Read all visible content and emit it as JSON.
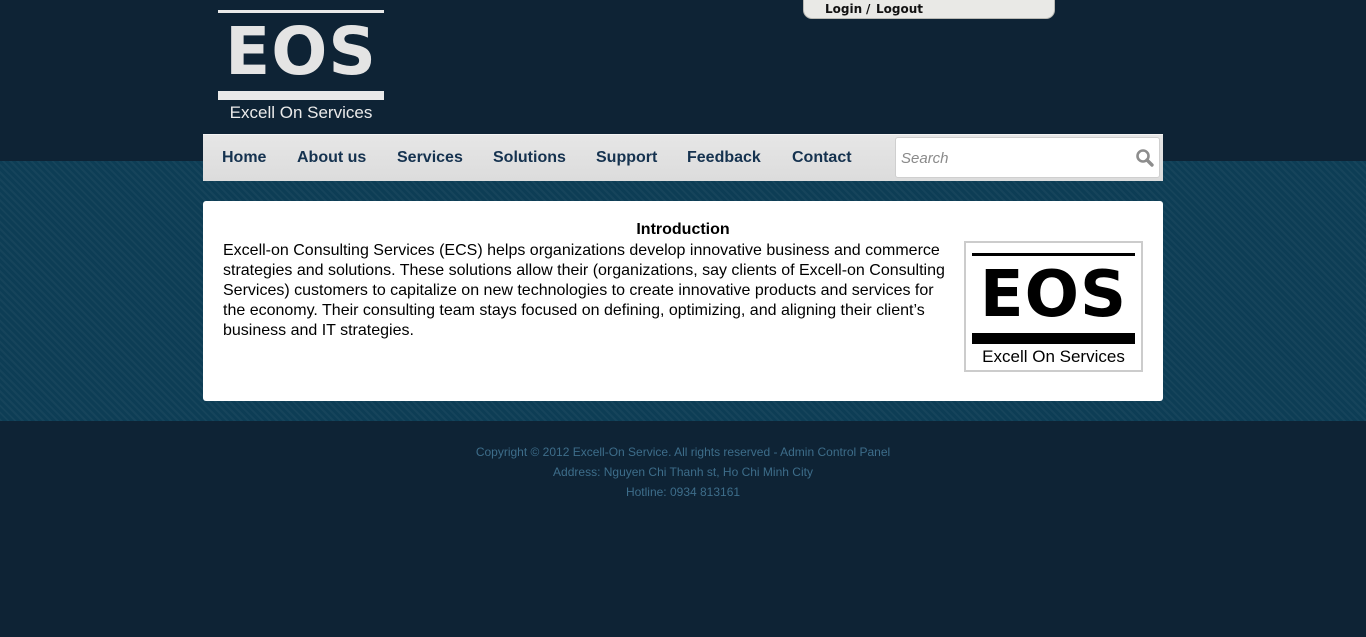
{
  "header": {
    "logo": {
      "mark": "EOS",
      "tagline": "Excell On Services"
    },
    "login_tab": {
      "login": "Login",
      "separator": "/",
      "logout": "Logout"
    }
  },
  "nav": {
    "items": [
      {
        "label": "Home"
      },
      {
        "label": "About us"
      },
      {
        "label": "Services"
      },
      {
        "label": "Solutions"
      },
      {
        "label": "Support"
      },
      {
        "label": "Feedback"
      },
      {
        "label": "Contact"
      }
    ],
    "search": {
      "placeholder": "Search",
      "value": "",
      "icon": "search-icon"
    }
  },
  "main": {
    "title": "Introduction",
    "body": "Excell-on Consulting Services (ECS) helps organizations develop innovative business and commerce strategies and solutions. These solutions allow their (organizations, say clients of Excell-on Consulting Services) customers to capitalize on new technologies to create innovative products and services for the economy. Their consulting team stays focused on defining, optimizing, and aligning their client’s business and IT strategies.",
    "image": {
      "mark": "EOS",
      "tagline": "Excell On Services"
    }
  },
  "footer": {
    "copyright": "Copyright © 2012 Excell-On Service. All rights reserved - ",
    "admin_link": "Admin Control Panel",
    "address": "Address: Nguyen Chi Thanh st, Ho Chi Minh City",
    "hotline": "Hotline: 0934 813161"
  },
  "colors": {
    "page_background": "#0e2335",
    "band": "#0d3d55",
    "nav_text": "#15324f",
    "footer_text": "#3d6d8a"
  }
}
